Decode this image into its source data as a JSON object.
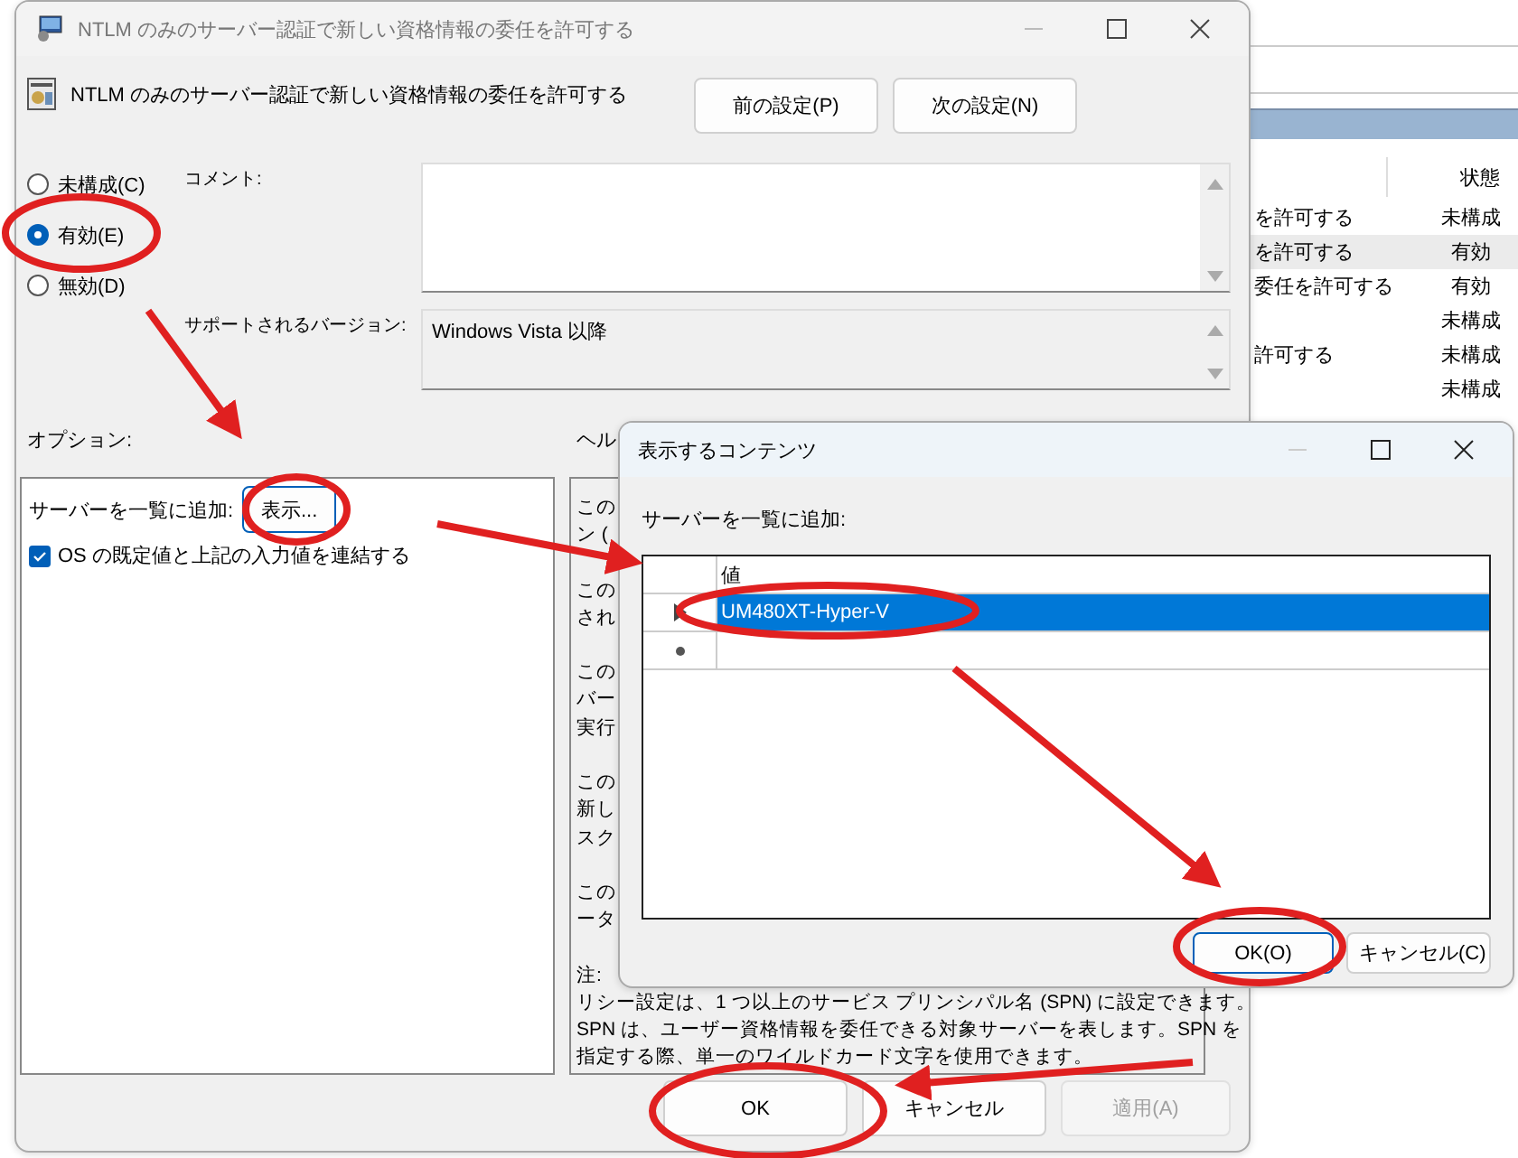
{
  "background_window": {
    "columns": [
      "状態"
    ],
    "rows": [
      {
        "name": "を許可する",
        "state": "未構成",
        "selected": false
      },
      {
        "name": "を許可する",
        "state": "有効",
        "selected": true
      },
      {
        "name": "委任を許可する",
        "state": "有効",
        "selected": false
      },
      {
        "state": "未構成",
        "selected": false
      },
      {
        "name": "許可する",
        "state": "未構成",
        "selected": false
      },
      {
        "state": "未構成",
        "selected": false
      }
    ]
  },
  "window": {
    "title": "NTLM のみのサーバー認証で新しい資格情報の委任を許可する"
  },
  "policy_title": "NTLM のみのサーバー認証で新しい資格情報の委任を許可する",
  "nav_buttons": [
    "前の設定(P)",
    "次の設定(N)"
  ],
  "radios": [
    {
      "label": "未構成(C)",
      "selected": false
    },
    {
      "label": "有効(E)",
      "selected": true
    },
    {
      "label": "無効(D)",
      "selected": false
    }
  ],
  "comment": {
    "label": "コメント:"
  },
  "supported": {
    "label": "サポートされるバージョン:",
    "value": "Windows Vista 以降"
  },
  "options": {
    "label": "オプション:",
    "server_list_label": "サーバーを一覧に追加:",
    "show_button": "表示...",
    "checkbox": {
      "label": "OS の既定値と上記の入力値を連結する",
      "checked": true
    }
  },
  "help": {
    "label": "ヘル",
    "paragraphs": [
      [
        "この",
        "ン ("
      ],
      [
        "この",
        "され"
      ],
      [
        "この",
        "バー",
        "実行"
      ],
      [
        "この",
        "新し",
        "スク"
      ],
      [
        "この",
        "ータ"
      ],
      [
        "注:",
        "リシー設定は、1 つ以上のサービス プリンシパル名 (SPN) に設定できます。",
        "SPN は、ユーザー資格情報を委任できる対象サーバーを表します。SPN を",
        "指定する際、単一のワイルドカード文字を使用できます。"
      ]
    ]
  },
  "buttons": [
    {
      "label": "OK",
      "disabled": false
    },
    {
      "label": "キャンセル",
      "disabled": false
    },
    {
      "label": "適用(A)",
      "disabled": true
    }
  ],
  "dialog": {
    "title": "表示するコンテンツ",
    "label": "サーバーを一覧に追加:",
    "column": "値",
    "rows": [
      {
        "value": "UM480XT-Hyper-V",
        "selected": true
      }
    ],
    "buttons": [
      "OK(O)",
      "キャンセル(C)"
    ]
  }
}
